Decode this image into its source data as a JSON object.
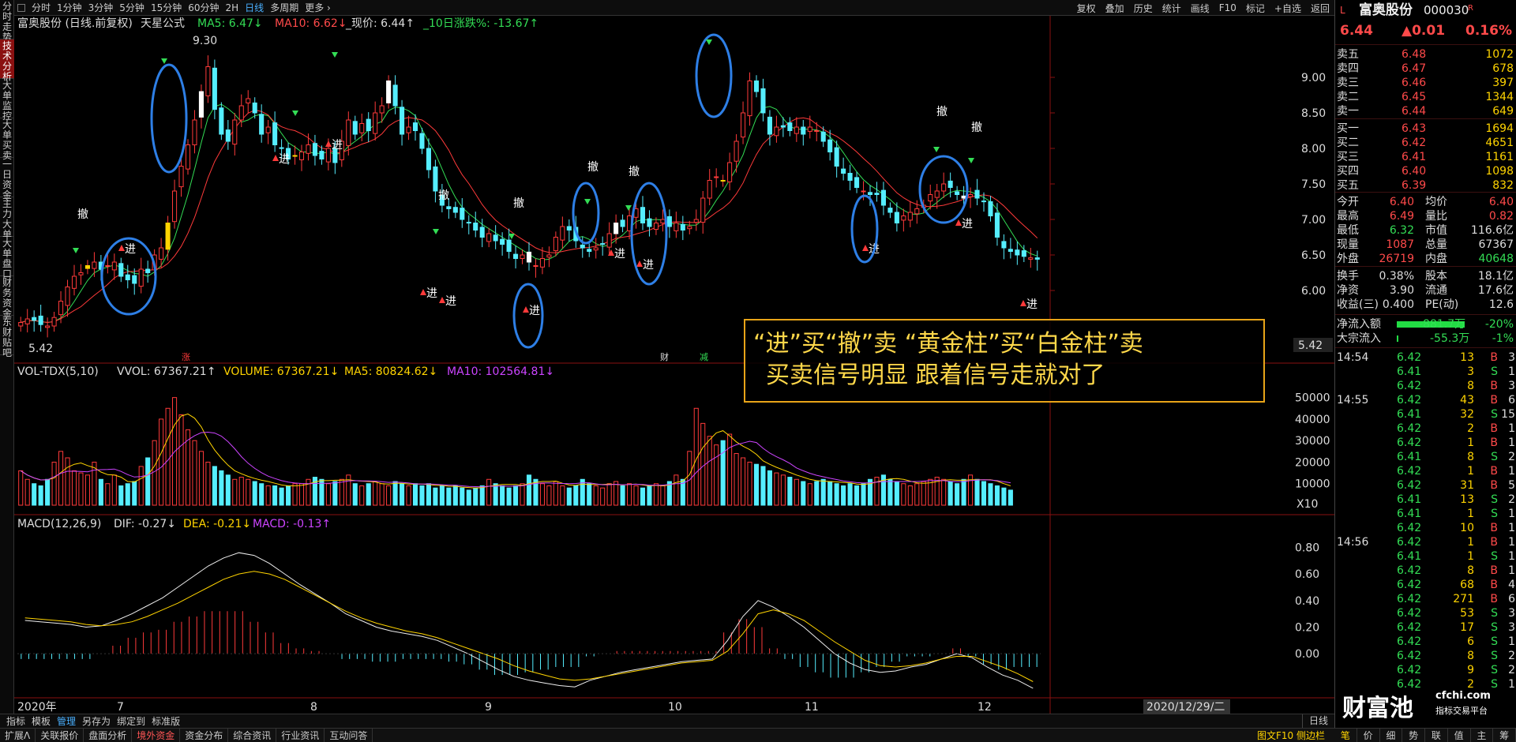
{
  "left_tabs": [
    "分时走势",
    "技术分析",
    "大单监控",
    "大单买卖",
    "一日资金",
    "主力大单",
    "大单盘口",
    "财务资金",
    "东财贴吧"
  ],
  "toolbar": {
    "periods": [
      "分时",
      "1分钟",
      "3分钟",
      "5分钟",
      "15分钟",
      "60分钟",
      "2H",
      "日线",
      "多周期",
      "更多 ›"
    ],
    "tools": [
      "复权",
      "叠加",
      "历史",
      "统计",
      "画线",
      "F10",
      "标记",
      "+自选",
      "返回"
    ]
  },
  "main_legend": {
    "title": "富奥股份 (日线.前复权)",
    "formula": "天星公式",
    "ma5": "MA5: 6.47↓",
    "ma10": "MA10: 6.62↓",
    "price": "_现价: 6.44↑",
    "chg10": "_10日涨跌%: -13.67↑"
  },
  "vol_legend": {
    "name": "VOL-TDX(5,10)",
    "vvol": "VVOL: 67367.21↑",
    "volume": "VOLUME: 67367.21↓",
    "ma5": "MA5: 80824.62↓",
    "ma10": "MA10: 102564.81↓"
  },
  "macd_legend": {
    "name": "MACD(12,26,9)",
    "dif": "DIF: -0.27↓",
    "dea": "DEA: -0.21↓",
    "macd": "MACD: -0.13↑"
  },
  "annotation": {
    "line1": "“进”买“撤”卖  “黄金柱”买“白金柱”卖",
    "line2": "买卖信号明显  跟着信号走就对了"
  },
  "signals": {
    "buy": "进",
    "sell": "撤",
    "finance": "财",
    "inc": "涨",
    "decr": "减"
  },
  "price_marks": {
    "high": "9.30",
    "low": "5.42",
    "current": "5.42"
  },
  "x_axis": [
    "2020年",
    "7",
    "8",
    "9",
    "10",
    "11",
    "12",
    "2020/12/29/二"
  ],
  "x_unit": "X10",
  "bottom_tabs": [
    "指标",
    "模板",
    "管理",
    "另存为",
    "绑定到",
    "标准版"
  ],
  "period_label": "日线",
  "status_tabs": [
    "扩展ᐱ",
    "关联报价",
    "盘面分析",
    "境外资金",
    "资金分布",
    "综合资讯",
    "行业资讯",
    "互动问答"
  ],
  "status_right": "图文F10 侧边栏",
  "quote": {
    "name": "富奥股份",
    "code": "000030",
    "price": "6.44",
    "change": "▲0.01",
    "pct": "0.16%",
    "asks": [
      {
        "label": "卖五",
        "price": "6.48",
        "vol": "1072"
      },
      {
        "label": "卖四",
        "price": "6.47",
        "vol": "678"
      },
      {
        "label": "卖三",
        "price": "6.46",
        "vol": "397"
      },
      {
        "label": "卖二",
        "price": "6.45",
        "vol": "1344"
      },
      {
        "label": "卖一",
        "price": "6.44",
        "vol": "649"
      }
    ],
    "bids": [
      {
        "label": "买一",
        "price": "6.43",
        "vol": "1694"
      },
      {
        "label": "买二",
        "price": "6.42",
        "vol": "4651"
      },
      {
        "label": "买三",
        "price": "6.41",
        "vol": "1161"
      },
      {
        "label": "买四",
        "price": "6.40",
        "vol": "1098"
      },
      {
        "label": "买五",
        "price": "6.39",
        "vol": "832"
      }
    ],
    "stats": [
      {
        "l1": "今开",
        "v1": "6.40",
        "l2": "均价",
        "v2": "6.40"
      },
      {
        "l1": "最高",
        "v1": "6.49",
        "l2": "量比",
        "v2": "0.82"
      },
      {
        "l1": "最低",
        "v1": "6.32",
        "l2": "市值",
        "v2": "116.6亿"
      },
      {
        "l1": "现量",
        "v1": "1087",
        "l2": "总量",
        "v2": "67367"
      },
      {
        "l1": "外盘",
        "v1": "26719",
        "l2": "内盘",
        "v2": "40648"
      }
    ],
    "stats2": [
      {
        "l1": "换手",
        "v1": "0.38%",
        "l2": "股本",
        "v2": "18.1亿"
      },
      {
        "l1": "净资",
        "v1": "3.90",
        "l2": "流通",
        "v2": "17.6亿"
      },
      {
        "l1": "收益(三)",
        "v1": "0.400",
        "l2": "PE(动)",
        "v2": "12.6"
      }
    ],
    "netflow": {
      "label": "净流入额",
      "value": "-881.7万",
      "pct": "-20%"
    },
    "bigflow": {
      "label": "大宗流入",
      "value": "-55.3万",
      "pct": "-1%"
    }
  },
  "ticks": [
    {
      "t": "14:54",
      "p": "6.42",
      "v": "13",
      "d": "B",
      "n": "3"
    },
    {
      "t": "",
      "p": "6.41",
      "v": "3",
      "d": "S",
      "n": "1"
    },
    {
      "t": "",
      "p": "6.42",
      "v": "8",
      "d": "B",
      "n": "3"
    },
    {
      "t": "14:55",
      "p": "6.42",
      "v": "43",
      "d": "B",
      "n": "6"
    },
    {
      "t": "",
      "p": "6.41",
      "v": "32",
      "d": "S",
      "n": "15"
    },
    {
      "t": "",
      "p": "6.42",
      "v": "2",
      "d": "B",
      "n": "1"
    },
    {
      "t": "",
      "p": "6.42",
      "v": "1",
      "d": "B",
      "n": "1"
    },
    {
      "t": "",
      "p": "6.41",
      "v": "8",
      "d": "S",
      "n": "2"
    },
    {
      "t": "",
      "p": "6.42",
      "v": "1",
      "d": "B",
      "n": "1"
    },
    {
      "t": "",
      "p": "6.42",
      "v": "31",
      "d": "B",
      "n": "5"
    },
    {
      "t": "",
      "p": "6.41",
      "v": "13",
      "d": "S",
      "n": "2"
    },
    {
      "t": "",
      "p": "6.41",
      "v": "1",
      "d": "S",
      "n": "1"
    },
    {
      "t": "",
      "p": "6.42",
      "v": "10",
      "d": "B",
      "n": "1"
    },
    {
      "t": "14:56",
      "p": "6.42",
      "v": "1",
      "d": "B",
      "n": "1"
    },
    {
      "t": "",
      "p": "6.41",
      "v": "1",
      "d": "S",
      "n": "1"
    },
    {
      "t": "",
      "p": "6.42",
      "v": "8",
      "d": "B",
      "n": "1"
    },
    {
      "t": "",
      "p": "6.42",
      "v": "68",
      "d": "B",
      "n": "4"
    },
    {
      "t": "",
      "p": "6.42",
      "v": "271",
      "d": "B",
      "n": "6"
    },
    {
      "t": "",
      "p": "6.42",
      "v": "53",
      "d": "S",
      "n": "3"
    },
    {
      "t": "",
      "p": "6.42",
      "v": "17",
      "d": "S",
      "n": "3"
    },
    {
      "t": "",
      "p": "6.42",
      "v": "6",
      "d": "S",
      "n": "1"
    },
    {
      "t": "",
      "p": "6.42",
      "v": "8",
      "d": "S",
      "n": "2"
    },
    {
      "t": "",
      "p": "6.42",
      "v": "9",
      "d": "S",
      "n": "2"
    },
    {
      "t": "",
      "p": "6.42",
      "v": "2",
      "d": "S",
      "n": "1"
    }
  ],
  "quote_tabs": [
    "笔",
    "价",
    "细",
    "势",
    "联",
    "值",
    "主",
    "筹"
  ],
  "watermark": {
    "brand": "财富池",
    "site": "cfchi.com",
    "sub": "指标交易平台"
  },
  "chart_data": {
    "type": "candlestick",
    "price_axis": {
      "ticks": [
        9.0,
        8.5,
        8.0,
        7.5,
        7.0,
        6.5,
        6.0
      ],
      "ylim": [
        5.2,
        9.6
      ]
    },
    "volume_axis": {
      "ticks": [
        50000,
        40000,
        30000,
        20000,
        10000
      ],
      "ylim": [
        0,
        55000
      ]
    },
    "macd_axis": {
      "ticks": [
        0.8,
        0.6,
        0.4,
        0.2,
        0.0
      ],
      "ylim": [
        -0.32,
        0.88
      ]
    },
    "close": [
      5.55,
      5.6,
      5.58,
      5.52,
      5.5,
      5.62,
      5.85,
      6.05,
      6.2,
      6.25,
      6.35,
      6.4,
      6.3,
      6.35,
      6.4,
      6.2,
      6.15,
      6.1,
      6.3,
      6.25,
      6.5,
      6.6,
      6.95,
      7.4,
      7.75,
      8.05,
      8.4,
      8.8,
      9.15,
      8.55,
      8.2,
      8.1,
      8.4,
      8.6,
      8.7,
      8.5,
      8.2,
      8.3,
      8.05,
      8.0,
      7.85,
      7.9,
      7.95,
      8.05,
      7.9,
      7.85,
      8.0,
      7.8,
      8.1,
      8.4,
      8.2,
      8.35,
      8.25,
      8.5,
      8.6,
      8.95,
      8.6,
      8.2,
      8.3,
      8.25,
      8.0,
      7.7,
      7.4,
      7.2,
      7.15,
      7.1,
      7.0,
      6.95,
      6.85,
      6.75,
      6.8,
      6.7,
      6.65,
      6.55,
      6.45,
      6.5,
      6.4,
      6.35,
      6.45,
      6.5,
      6.75,
      6.9,
      6.85,
      6.7,
      6.6,
      6.55,
      6.6,
      6.65,
      6.8,
      6.95,
      6.9,
      7.05,
      7.15,
      6.95,
      6.9,
      6.95,
      7.0,
      6.9,
      6.95,
      6.85,
      6.9,
      7.0,
      7.3,
      7.55,
      7.6,
      7.55,
      7.8,
      8.1,
      8.5,
      8.95,
      8.8,
      8.5,
      8.2,
      8.3,
      8.3,
      8.25,
      8.3,
      8.2,
      8.3,
      8.25,
      8.1,
      7.95,
      7.75,
      7.65,
      7.55,
      7.45,
      7.4,
      7.35,
      7.35,
      7.2,
      7.1,
      6.95,
      7.05,
      7.1,
      7.15,
      7.2,
      7.35,
      7.4,
      7.5,
      7.45,
      7.35,
      7.3,
      7.35,
      7.3,
      7.25,
      7.05,
      6.75,
      6.6,
      6.55,
      6.5,
      6.48,
      6.46,
      6.44
    ],
    "volume": [
      16000,
      12000,
      10000,
      9000,
      12000,
      20000,
      25000,
      22000,
      16000,
      15000,
      14000,
      20000,
      12000,
      10000,
      14000,
      9000,
      10000,
      11000,
      18000,
      22000,
      30000,
      40000,
      45000,
      50000,
      42000,
      35000,
      30000,
      25000,
      20000,
      18000,
      16000,
      14000,
      12000,
      13000,
      12000,
      11000,
      10000,
      9000,
      9000,
      8000,
      9000,
      10000,
      10000,
      12000,
      13000,
      12000,
      10000,
      11000,
      12000,
      14000,
      10000,
      9000,
      10000,
      11000,
      10000,
      9000,
      11000,
      10000,
      9000,
      10000,
      9000,
      10000,
      8000,
      9000,
      8000,
      9000,
      8000,
      7000,
      8000,
      9000,
      12000,
      10000,
      9000,
      8000,
      9000,
      10000,
      14000,
      12000,
      10000,
      9000,
      11000,
      9000,
      8000,
      9000,
      12000,
      10000,
      9000,
      8000,
      10000,
      11000,
      9000,
      10000,
      9000,
      8000,
      9000,
      10000,
      9000,
      11000,
      14000,
      12000,
      25000,
      45000,
      38000,
      32000,
      28000,
      30000,
      33000,
      24000,
      22000,
      20000,
      19000,
      18000,
      16000,
      15000,
      14000,
      13000,
      12000,
      11000,
      10000,
      11000,
      12000,
      11000,
      10000,
      9000,
      10000,
      9000,
      10000,
      12000,
      13000,
      14000,
      12000,
      11000,
      10000,
      9000,
      10000,
      11000,
      12000,
      13000,
      12000,
      11000,
      10000,
      12000,
      14000,
      12000,
      11000,
      10000,
      9000,
      8000,
      7000
    ],
    "dif": [
      0.25,
      0.24,
      0.23,
      0.22,
      0.2,
      0.21,
      0.25,
      0.3,
      0.36,
      0.42,
      0.5,
      0.58,
      0.66,
      0.72,
      0.76,
      0.74,
      0.68,
      0.6,
      0.52,
      0.45,
      0.38,
      0.3,
      0.25,
      0.2,
      0.17,
      0.15,
      0.13,
      0.1,
      0.05,
      0.0,
      -0.06,
      -0.12,
      -0.17,
      -0.2,
      -0.22,
      -0.24,
      -0.25,
      -0.2,
      -0.17,
      -0.14,
      -0.12,
      -0.1,
      -0.08,
      -0.06,
      -0.05,
      -0.04,
      0.1,
      0.28,
      0.4,
      0.35,
      0.28,
      0.2,
      0.1,
      0.0,
      -0.07,
      -0.12,
      -0.14,
      -0.13,
      -0.1,
      -0.08,
      -0.04,
      0.0,
      -0.03,
      -0.1,
      -0.16,
      -0.2,
      -0.26
    ],
    "dea": [
      0.27,
      0.26,
      0.25,
      0.24,
      0.22,
      0.21,
      0.22,
      0.24,
      0.28,
      0.33,
      0.38,
      0.44,
      0.5,
      0.56,
      0.6,
      0.62,
      0.6,
      0.56,
      0.5,
      0.44,
      0.38,
      0.32,
      0.27,
      0.23,
      0.2,
      0.17,
      0.15,
      0.12,
      0.08,
      0.04,
      0.0,
      -0.04,
      -0.09,
      -0.13,
      -0.16,
      -0.19,
      -0.2,
      -0.19,
      -0.17,
      -0.15,
      -0.13,
      -0.11,
      -0.09,
      -0.07,
      -0.06,
      -0.05,
      0.02,
      0.15,
      0.3,
      0.33,
      0.3,
      0.25,
      0.17,
      0.09,
      0.02,
      -0.05,
      -0.09,
      -0.1,
      -0.09,
      -0.07,
      -0.04,
      -0.02,
      -0.02,
      -0.06,
      -0.1,
      -0.15,
      -0.21
    ]
  }
}
